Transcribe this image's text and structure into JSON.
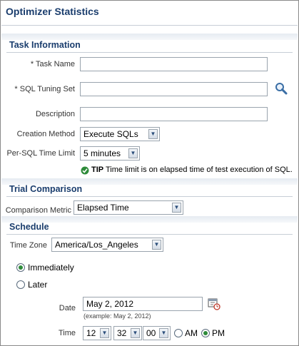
{
  "page_title": "Optimizer Statistics",
  "task_information": {
    "title": "Task Information",
    "task_name_label": "Task Name",
    "task_name_value": "",
    "sql_tuning_set_label": "SQL Tuning Set",
    "sql_tuning_set_value": "",
    "description_label": "Description",
    "description_value": "",
    "creation_method_label": "Creation Method",
    "creation_method_value": "Execute SQLs",
    "time_limit_label": "Per-SQL Time Limit",
    "time_limit_value": "5 minutes",
    "tip_label": "TIP",
    "tip_text": "Time limit is on elapsed time of test execution of SQL.",
    "required_marker": "*"
  },
  "trial_comparison": {
    "title": "Trial Comparison",
    "metric_label": "Comparison Metric",
    "metric_value": "Elapsed Time"
  },
  "schedule": {
    "title": "Schedule",
    "time_zone_label": "Time Zone",
    "time_zone_value": "America/Los_Angeles",
    "immediately_label": "Immediately",
    "later_label": "Later",
    "selected": "Immediately",
    "date_label": "Date",
    "date_value": "May 2, 2012",
    "date_hint": "(example: May 2, 2012)",
    "time_label": "Time",
    "hour": "12",
    "minute": "32",
    "second": "00",
    "am_label": "AM",
    "pm_label": "PM",
    "meridiem": "PM"
  },
  "colors": {
    "heading": "#1a3d6d",
    "tip_check": "#2e8b3a",
    "search_icon": "#3a6ea5"
  }
}
